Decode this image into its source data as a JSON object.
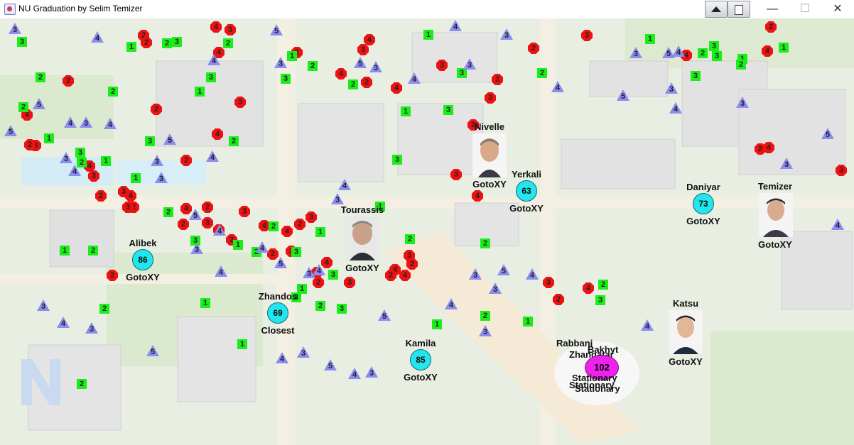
{
  "window": {
    "title": "NU Graduation by Selim Temizer",
    "icons": {
      "app": "java-app-icon",
      "up": "triangle-up-icon",
      "pin": "pin-icon"
    },
    "controls": {
      "minimize": "—",
      "maximize": "☐",
      "close": "✕"
    }
  },
  "colors": {
    "red": "#ee1111",
    "green": "#19ee19",
    "blue": "#8a8cf2",
    "cyan": "#22e5ee",
    "magenta": "#ee22ee"
  },
  "agents": [
    {
      "name": "Alibek",
      "value": "86",
      "action": "GotoXY"
    },
    {
      "name": "Zhandos",
      "value": "69",
      "action": "Closest"
    },
    {
      "name": "Kamila",
      "value": "85",
      "action": "GotoXY"
    },
    {
      "name": "Yerkali",
      "value": "63",
      "action": "GotoXY"
    },
    {
      "name": "Daniyar",
      "value": "73",
      "action": "GotoXY"
    }
  ],
  "people": [
    {
      "name": "Nivelle",
      "action": "GotoXY"
    },
    {
      "name": "Tourassis",
      "action": "GotoXY"
    },
    {
      "name": "Temizer",
      "action": "GotoXY"
    },
    {
      "name": "Katsu",
      "action": "GotoXY"
    }
  ],
  "cluster": {
    "names": [
      "Rabbani",
      "Zhangatar",
      "Bakhyt"
    ],
    "value": "102",
    "labels": [
      "Stationary",
      "Stationary",
      "Stationary"
    ]
  },
  "red_values": [
    "2",
    "4",
    "3",
    "2",
    "4",
    "2",
    "3",
    "4",
    "2",
    "3",
    "4",
    "2",
    "4",
    "2",
    "3",
    "4",
    "2",
    "4",
    "3",
    "2",
    "3",
    "2",
    "4",
    "3",
    "2",
    "4",
    "2",
    "3",
    "4",
    "2",
    "3",
    "4",
    "2",
    "3",
    "4",
    "2",
    "2",
    "3",
    "4",
    "3",
    "2",
    "4",
    "2",
    "3",
    "4",
    "2",
    "3",
    "4",
    "2",
    "4",
    "3",
    "2",
    "4",
    "2",
    "3",
    "2",
    "4",
    "3",
    "2",
    "3",
    "4",
    "2",
    "3",
    "2",
    "4",
    "2"
  ],
  "green_values": [
    "3",
    "1",
    "2",
    "3",
    "2",
    "1",
    "3",
    "2",
    "1",
    "3",
    "2",
    "1",
    "3",
    "2",
    "3",
    "1",
    "2",
    "1",
    "3",
    "2",
    "2",
    "1",
    "3",
    "2",
    "1",
    "3",
    "2",
    "1",
    "3",
    "2",
    "1",
    "3",
    "2",
    "3",
    "1",
    "2",
    "3",
    "1",
    "2",
    "1",
    "2",
    "3",
    "1",
    "2",
    "2",
    "3",
    "1",
    "2",
    "1",
    "3",
    "2",
    "3",
    "1",
    "2",
    "1",
    "2",
    "3",
    "1",
    "2",
    "1",
    "2"
  ],
  "blue_values": [
    "3",
    "4",
    "5",
    "3",
    "4",
    "3",
    "5",
    "4",
    "3",
    "4",
    "5",
    "3",
    "4",
    "3",
    "4",
    "5",
    "3",
    "4",
    "3",
    "5",
    "4",
    "3",
    "4",
    "5",
    "3",
    "4",
    "3",
    "5",
    "4",
    "3",
    "4",
    "3",
    "5",
    "4",
    "3",
    "4",
    "5",
    "3",
    "4",
    "3",
    "5",
    "4",
    "3",
    "4",
    "3",
    "5",
    "4",
    "3",
    "5",
    "4",
    "3",
    "4",
    "3",
    "5",
    "4",
    "4",
    "3",
    "5",
    "4",
    "3"
  ]
}
